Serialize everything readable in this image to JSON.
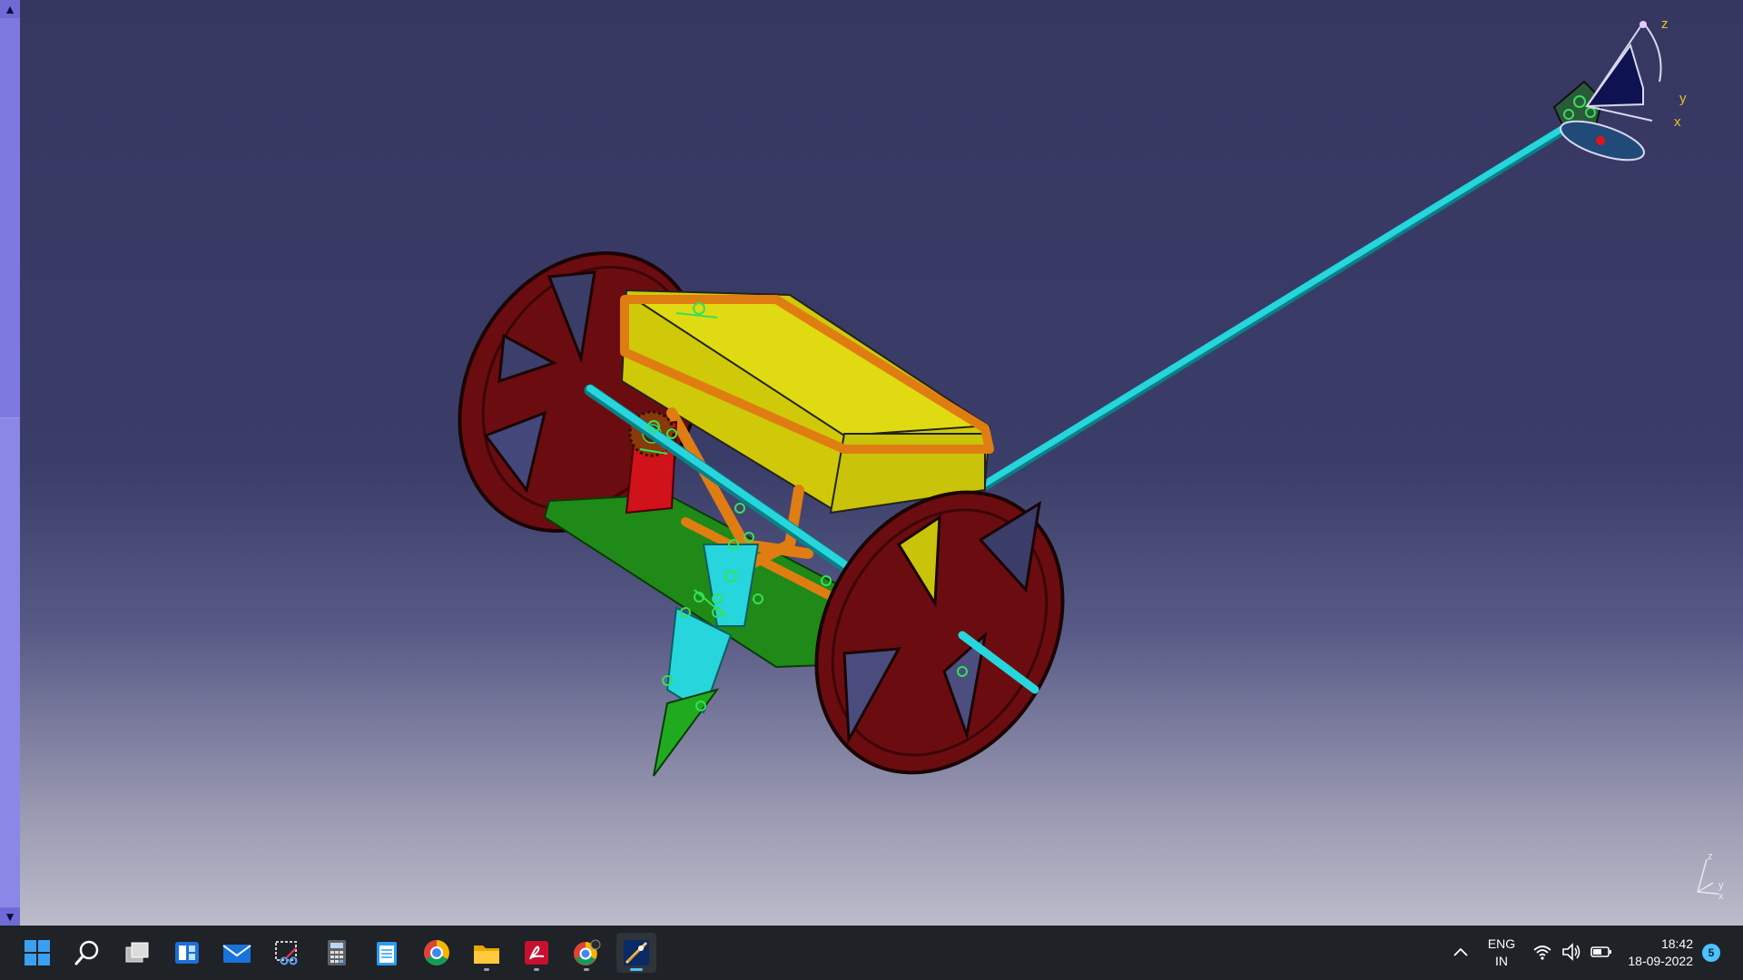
{
  "viewer": {
    "axis_labels": {
      "z": "z",
      "y": "y",
      "x": "x"
    },
    "triad_labels": {
      "z": "z",
      "y": "y",
      "x": "x"
    },
    "scroll_up_glyph": "▲",
    "scroll_down_glyph": "▼"
  },
  "taskbar": {
    "apps": [
      {
        "name": "start-icon"
      },
      {
        "name": "search-icon"
      },
      {
        "name": "task-view-icon"
      },
      {
        "name": "widgets-icon"
      },
      {
        "name": "mail-icon"
      },
      {
        "name": "snipping-tool-icon"
      },
      {
        "name": "calculator-icon"
      },
      {
        "name": "notepad-icon"
      },
      {
        "name": "chrome-icon"
      },
      {
        "name": "file-explorer-icon"
      },
      {
        "name": "acrobat-icon"
      },
      {
        "name": "chrome-profile-icon"
      },
      {
        "name": "catia-icon"
      }
    ],
    "tray": {
      "language": "ENG",
      "region": "IN",
      "time": "18:42",
      "date": "18-09-2022",
      "notification_count": "5"
    }
  },
  "colors": {
    "wheel": "#6b0d10",
    "hopper": "#cfc909",
    "frame": "#e07d12",
    "base_plate": "#1f8a17",
    "shaft": "#22d0d6",
    "taskbar_bg": "#1f2227",
    "accent": "#4cc2ff"
  }
}
